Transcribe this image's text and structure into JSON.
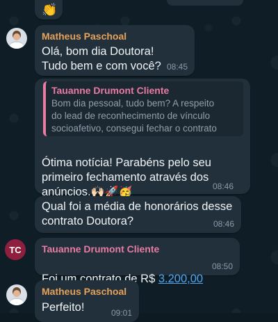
{
  "top_reaction": {
    "emoji": "👏"
  },
  "messages": [
    {
      "sender": "Matheus Paschoal",
      "text": "Olá, bom dia Doutora!\nTudo bem e com você?",
      "time": "08:45"
    },
    {
      "quote": {
        "sender": "Tauanne Drumont Cliente",
        "text": "Bom dia pessoal, tudo bem? A respeito\ndo lead de reconhecimento de vínculo\nsocioafetivo, consegui fechar o contrato"
      },
      "text": "Ótima notícia! Parabéns pelo seu\nprimeiro fechamento através dos\nanúncios.",
      "emojis": "🙌🏻🚀🥳",
      "time": "08:46"
    },
    {
      "text": "Qual foi a média de honorários desse\ncontrato Doutora?",
      "time": "08:46"
    },
    {
      "avatar_initials": "TC",
      "sender": "Tauanne Drumont Cliente",
      "text_prefix": "Foi um contrato de R$ ",
      "link_text": "3.200,00",
      "time": "08:50"
    },
    {
      "sender": "Matheus Paschoal",
      "text": "Perfeito!",
      "time": "09:01"
    }
  ]
}
